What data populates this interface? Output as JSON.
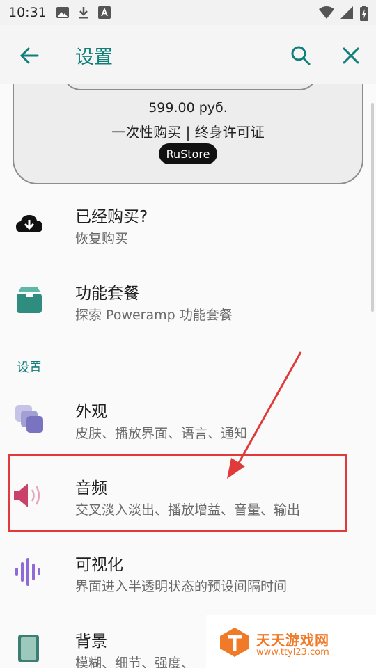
{
  "status": {
    "time": "10:31"
  },
  "app_bar": {
    "title": "设置"
  },
  "purchase": {
    "price": "599.00 руб.",
    "license": "一次性购买 | 终身许可证",
    "store": "RuStore"
  },
  "items": [
    {
      "title": "已经购买?",
      "subtitle": "恢复购买",
      "icon": "cloud-download-icon"
    },
    {
      "title": "功能套餐",
      "subtitle": "探索 Poweramp 功能套餐",
      "icon": "package-icon"
    }
  ],
  "settings_section": {
    "header": "设置",
    "items": [
      {
        "title": "外观",
        "subtitle": "皮肤、播放界面、语言、通知",
        "icon": "appearance-icon"
      },
      {
        "title": "音频",
        "subtitle": "交叉淡入淡出、播放增益、音量、输出",
        "icon": "speaker-icon"
      },
      {
        "title": "可视化",
        "subtitle": "界面进入半透明状态的预设间隔时间",
        "icon": "waveform-icon"
      },
      {
        "title": "背景",
        "subtitle": "模糊、细节、强度、",
        "icon": "background-icon"
      }
    ]
  },
  "watermark": {
    "title": "天天游戏网",
    "url": "www.ttyl23.com"
  },
  "colors": {
    "accent": "#0f7f7a",
    "annotation": "#e03a3a"
  }
}
